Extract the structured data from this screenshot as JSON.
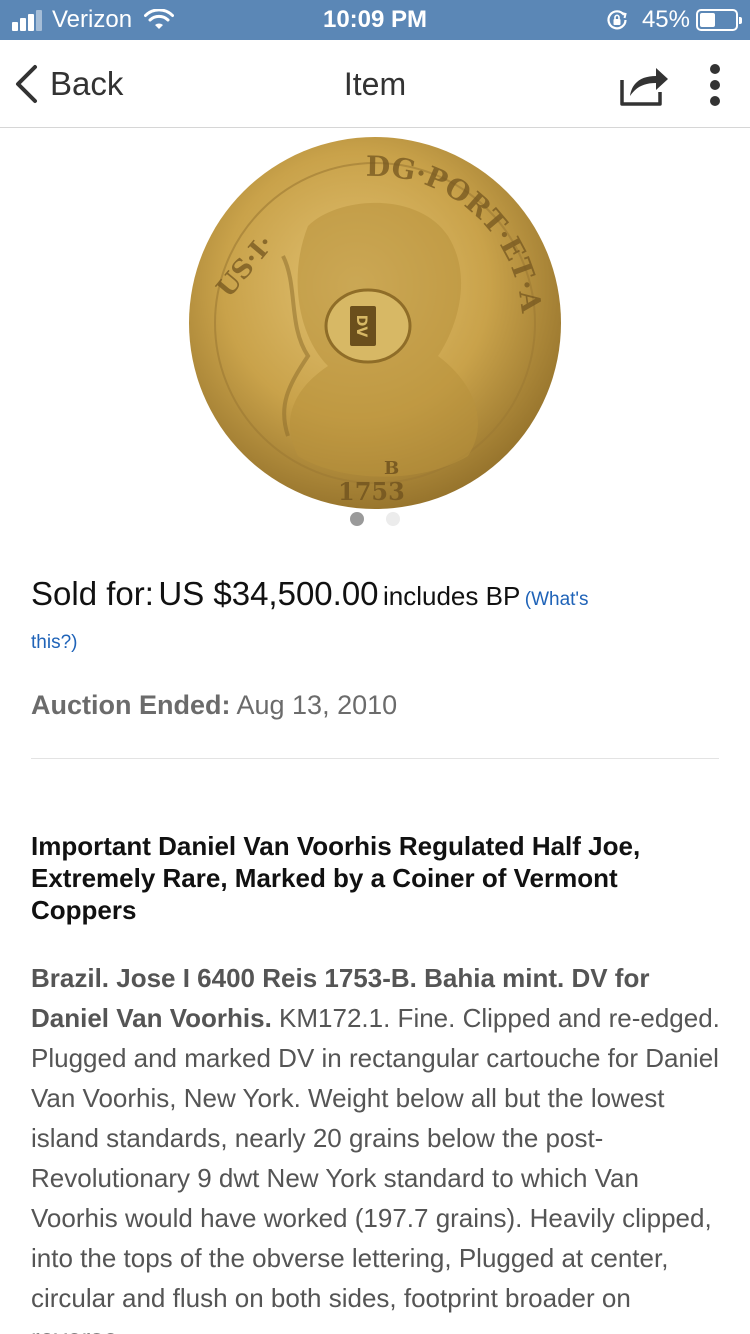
{
  "status_bar": {
    "carrier": "Verizon",
    "time": "10:09 PM",
    "battery_percent": "45%",
    "battery_level": 0.45,
    "icons": [
      "signal-icon",
      "wifi-icon",
      "rotation-lock-icon",
      "battery-icon"
    ]
  },
  "nav": {
    "back_label": "Back",
    "title": "Item",
    "icons": [
      "back-chevron-icon",
      "share-icon",
      "more-icon"
    ]
  },
  "carousel": {
    "image_count": 2,
    "active_index": 0,
    "coin_inscription_top": "DG·PORT·ET·ALG·REX",
    "coin_inscription_left": "US·I·",
    "coin_date": "1753",
    "coin_mint_mark": "B",
    "coin_stamp": "DV"
  },
  "price": {
    "sold_prefix": "Sold for:",
    "sold_amount": "US $34,500.00",
    "sold_suffix": "includes BP",
    "whats_this_part1": "(What's",
    "whats_this_part2": "this?)"
  },
  "auction": {
    "ended_label": "Auction Ended:",
    "ended_date": "Aug 13, 2010"
  },
  "item": {
    "title": "Important Daniel Van Voorhis Regulated Half Joe, Extremely Rare, Marked by a Coiner of Vermont Coppers",
    "description_lead": "Brazil. Jose I 6400 Reis 1753-B. Bahia mint. DV for Daniel Van Voorhis.",
    "description_body": "KM172.1. Fine. Clipped and re-edged. Plugged and marked DV in rectangular cartouche for Daniel Van Voorhis, New York. Weight below all but the lowest island standards, nearly 20 grains below the post-Revolutionary 9 dwt New York standard to which Van Voorhis would have worked (197.7 grains). Heavily clipped, into the tops of the obverse lettering, Plugged at center, circular and flush on both sides, footprint broader on reverse"
  },
  "colors": {
    "status_bar_bg": "#5b87b6",
    "link": "#1f63b8",
    "muted_text": "#6b6b6b",
    "coin_gold": "#c9a24a"
  }
}
